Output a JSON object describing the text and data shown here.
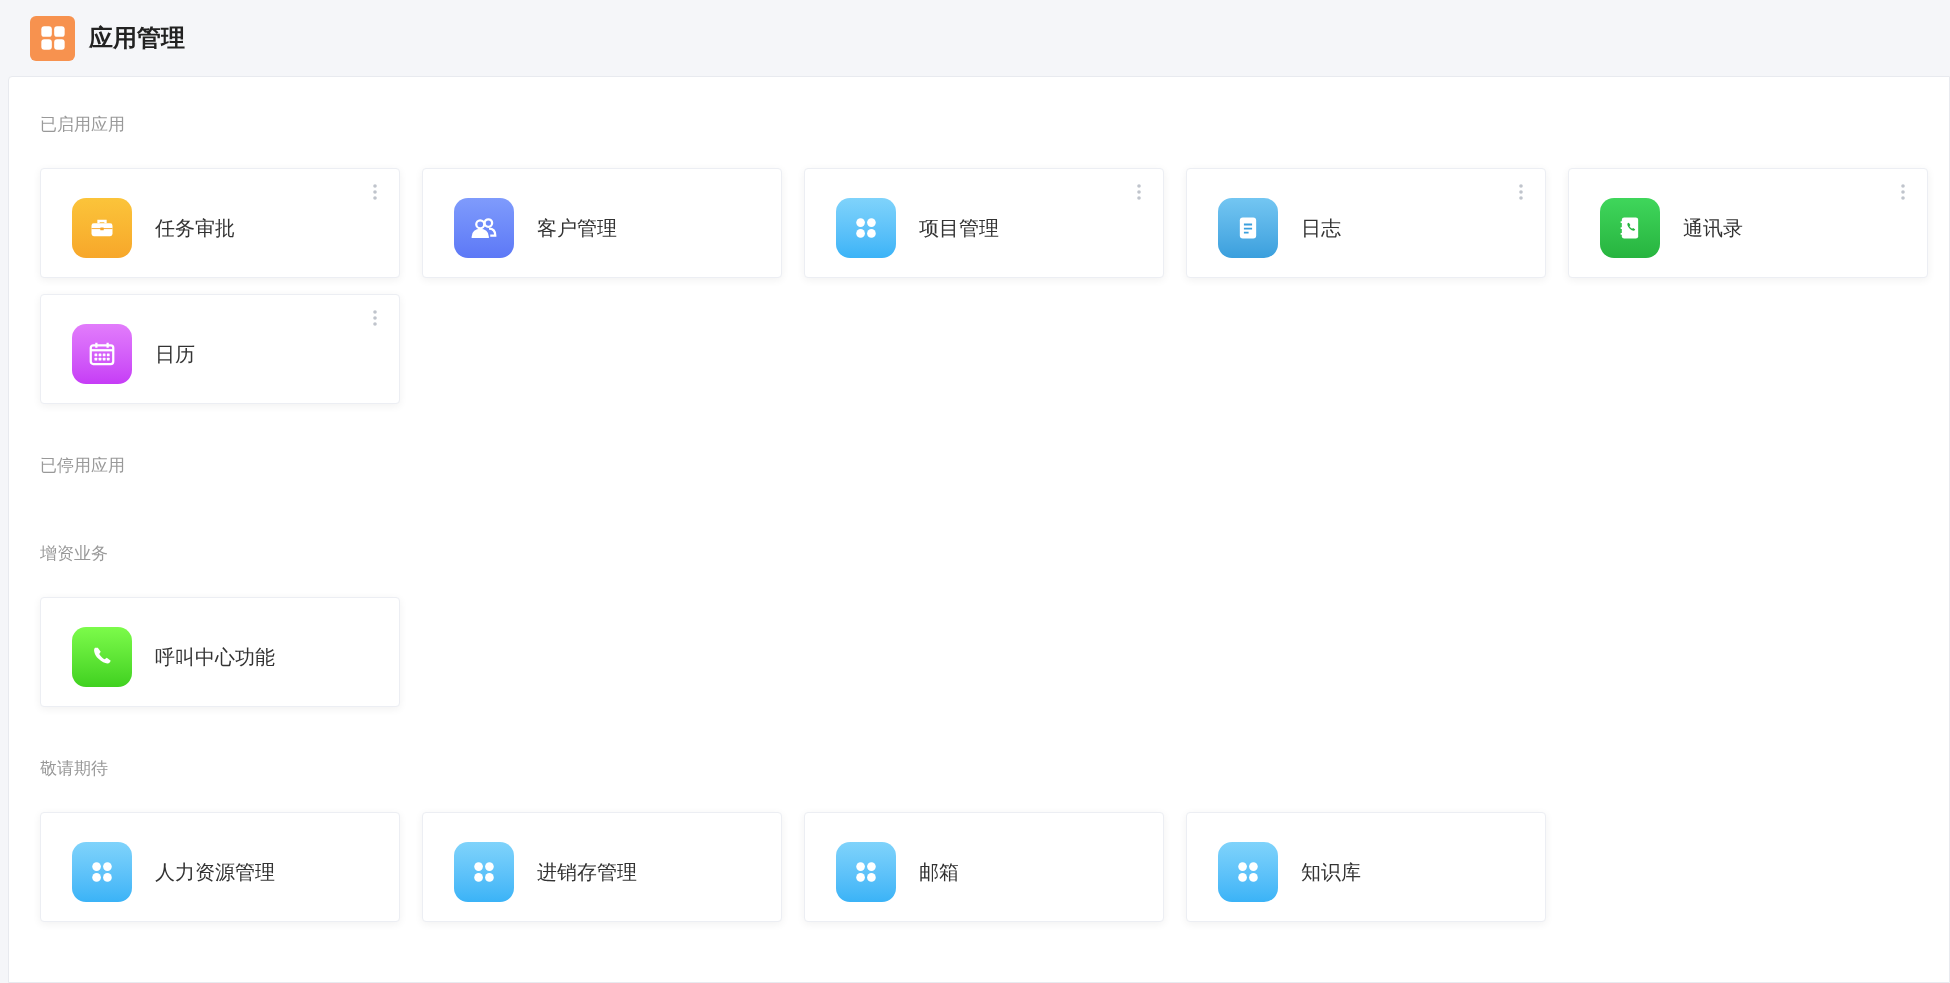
{
  "header": {
    "title": "应用管理"
  },
  "sections": [
    {
      "title": "已启用应用",
      "apps": [
        {
          "name": "任务审批",
          "kind": "briefcase",
          "menu": true
        },
        {
          "name": "客户管理",
          "kind": "users",
          "menu": false
        },
        {
          "name": "项目管理",
          "kind": "clover",
          "menu": true
        },
        {
          "name": "日志",
          "kind": "note",
          "menu": true
        },
        {
          "name": "通讯录",
          "kind": "contacts",
          "menu": true
        },
        {
          "name": "日历",
          "kind": "calendar",
          "menu": true
        }
      ]
    },
    {
      "title": "已停用应用"
    },
    {
      "title": "增资业务",
      "apps": [
        {
          "name": "呼叫中心功能",
          "kind": "phone",
          "menu": false
        }
      ]
    },
    {
      "title": "敬请期待",
      "apps": [
        {
          "name": "人力资源管理",
          "kind": "clover",
          "menu": false
        },
        {
          "name": "进销存管理",
          "kind": "clover",
          "menu": false
        },
        {
          "name": "邮箱",
          "kind": "clover",
          "menu": false
        },
        {
          "name": "知识库",
          "kind": "clover",
          "menu": false
        }
      ]
    }
  ]
}
